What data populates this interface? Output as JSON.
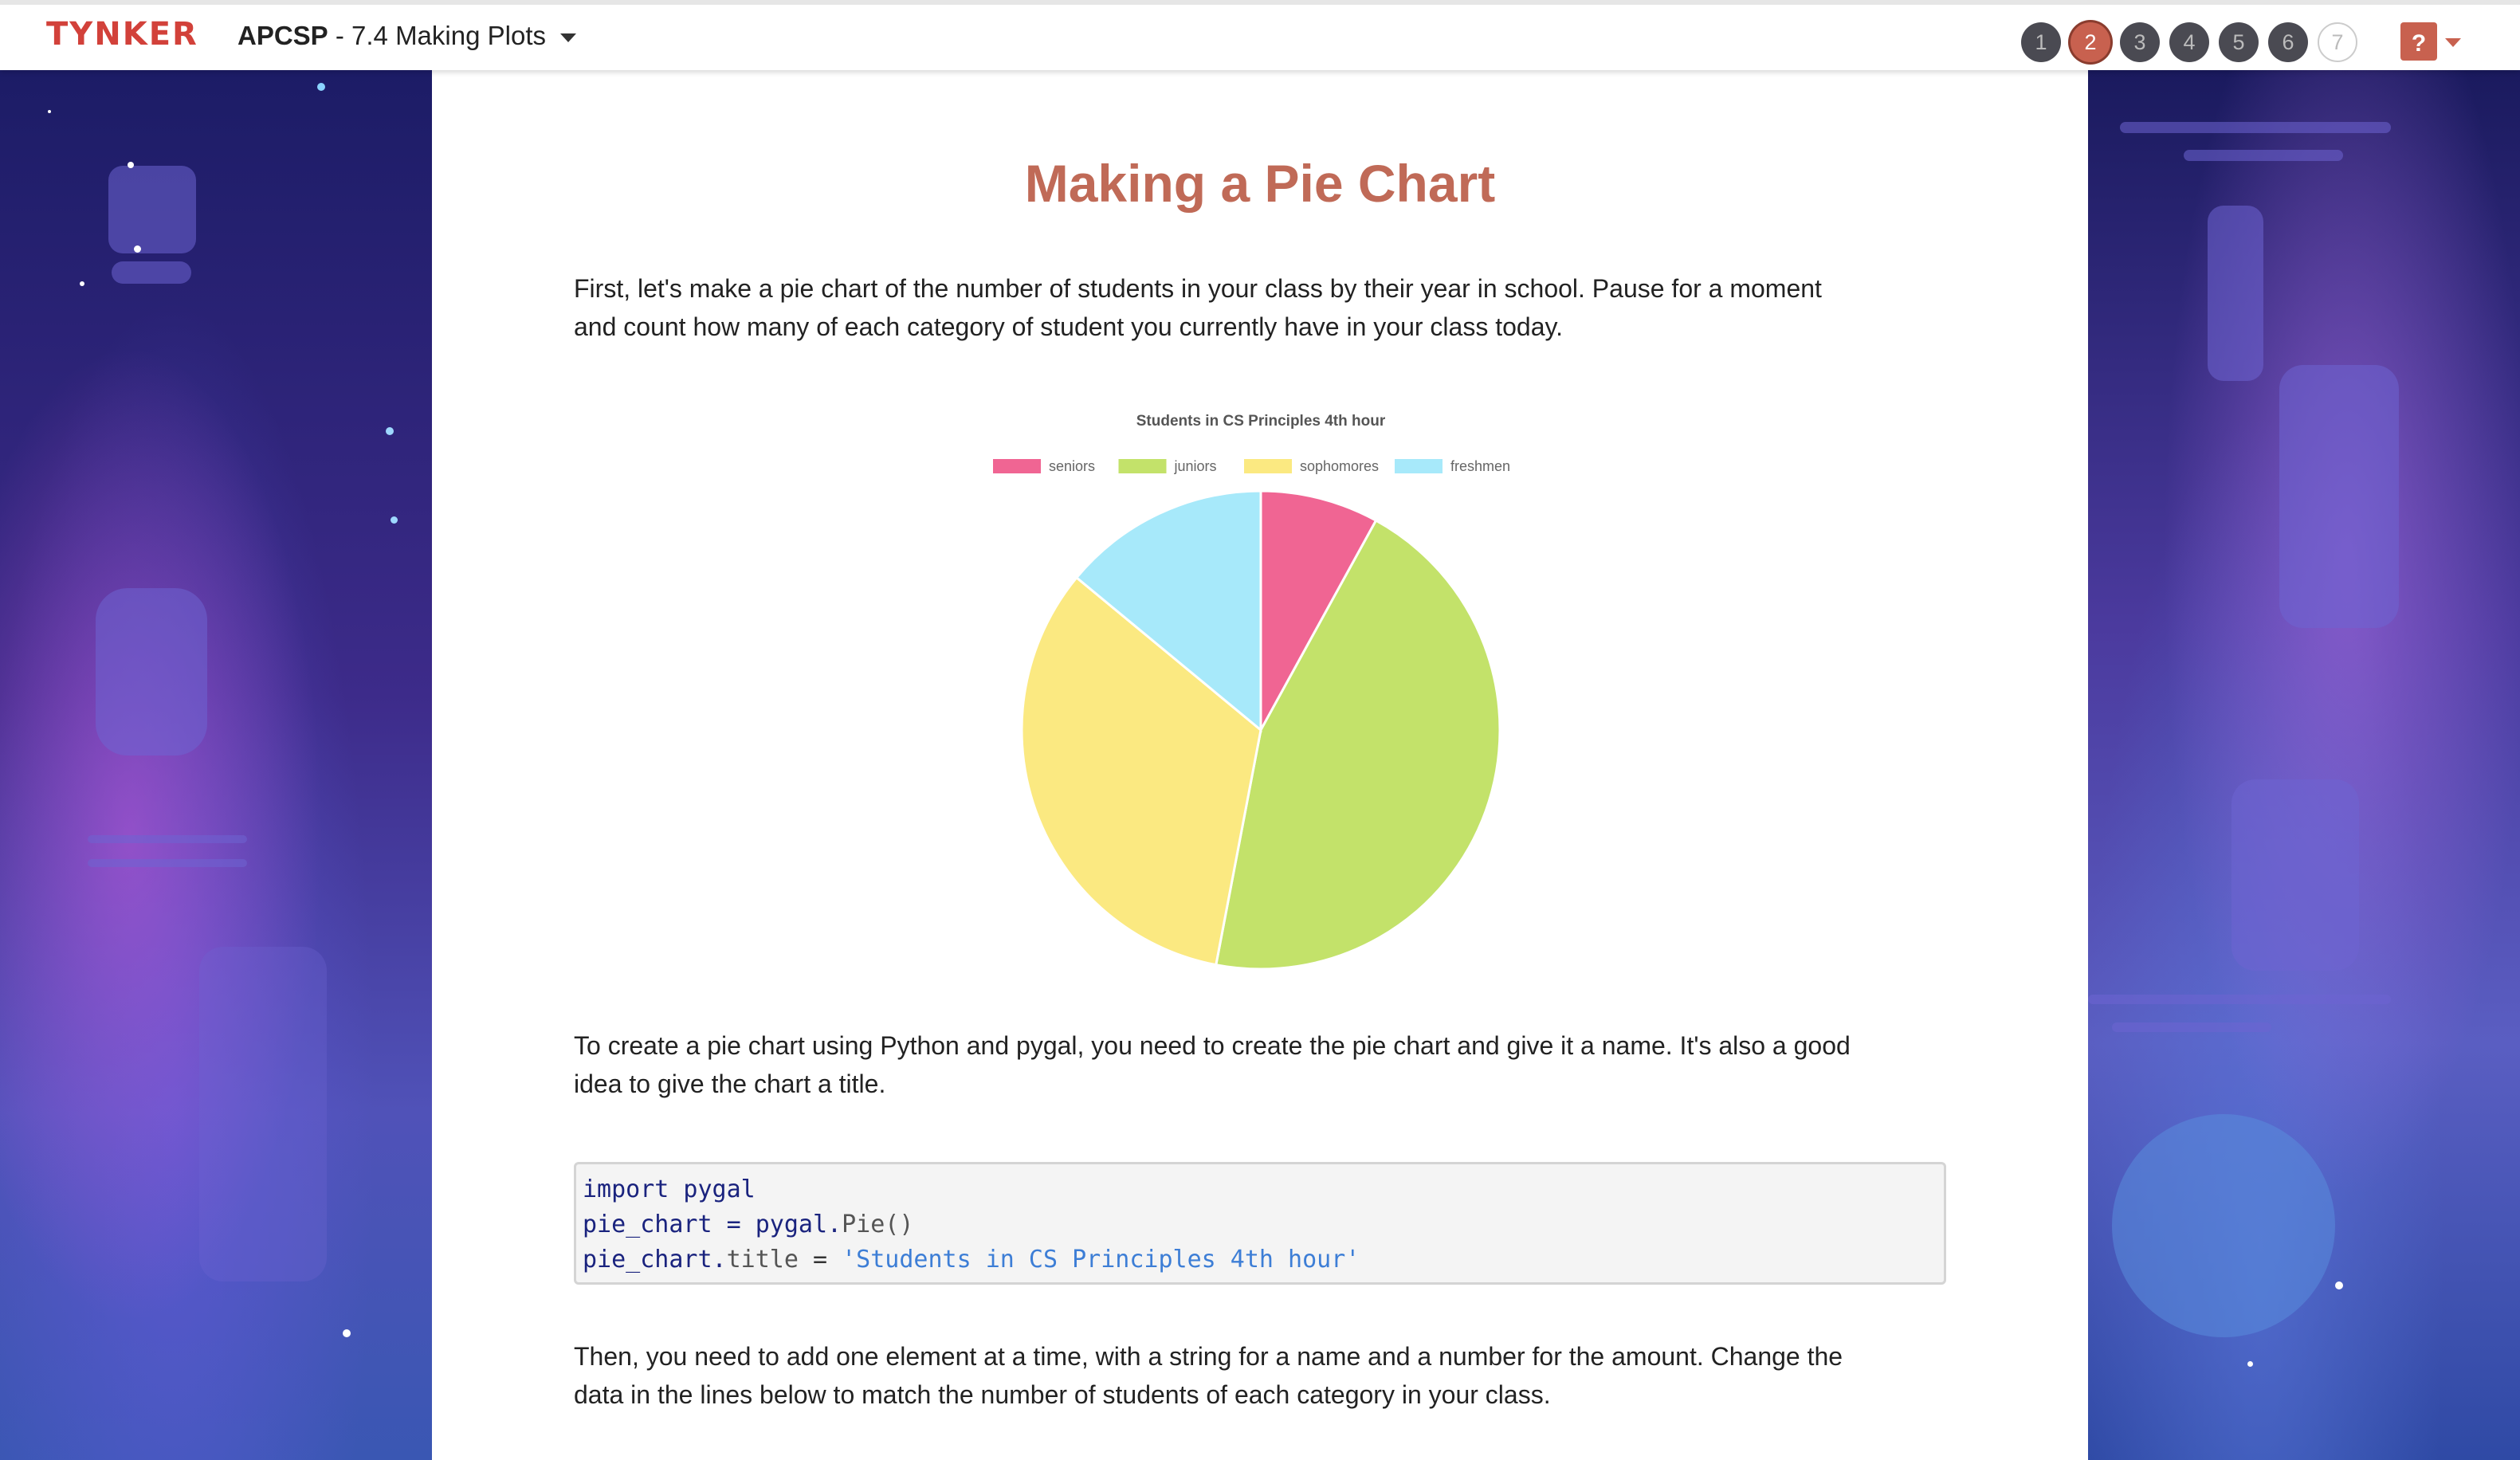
{
  "topbar": {
    "logo_text": "TYNKER",
    "course_bold": "APCSP",
    "course_rest": " - 7.4 Making Plots",
    "steps": [
      {
        "label": "1",
        "state": "done"
      },
      {
        "label": "2",
        "state": "current"
      },
      {
        "label": "3",
        "state": "done"
      },
      {
        "label": "4",
        "state": "done"
      },
      {
        "label": "5",
        "state": "done"
      },
      {
        "label": "6",
        "state": "done"
      },
      {
        "label": "7",
        "state": "upcoming"
      }
    ],
    "help_label": "?"
  },
  "colors": {
    "accent": "#c06a57",
    "step_done": "#4a4a52",
    "step_current": "#c8614f",
    "step_upcoming_border": "#cccccc"
  },
  "main": {
    "title": "Making a Pie Chart",
    "para1_line1": "First, let's make a pie chart of the number of students in your class by their year in school. Pause for a moment",
    "para1_line2": "and count how many of each category of student you currently have in your class today.",
    "para2_line1": "To create a pie chart using Python and pygal, you need to create the pie chart and give it a name. It's also a good",
    "para2_line2": "idea to give the chart a title.",
    "code": {
      "line1_kw": "import pygal",
      "line2_a": "pie_chart = pygal.",
      "line2_b": "Pie()",
      "line3_a": "pie_chart.",
      "line3_b": "title",
      "line3_c": " = ",
      "line3_d": "'Students in CS Principles 4th hour'"
    },
    "para3_line1": "Then, you need to add one element at a time, with a string for a name and a number for the amount. Change the",
    "para3_line2": "data in the lines below to match the number of students of each category in your class."
  },
  "chart_data": {
    "type": "pie",
    "title": "Students in CS Principles 4th hour",
    "legend_position": "top",
    "categories": [
      "seniors",
      "juniors",
      "sophomores",
      "freshmen"
    ],
    "values": [
      8,
      45,
      33,
      14
    ],
    "colors": [
      "#f06593",
      "#c3e26a",
      "#fbe981",
      "#a7e9fa"
    ]
  }
}
